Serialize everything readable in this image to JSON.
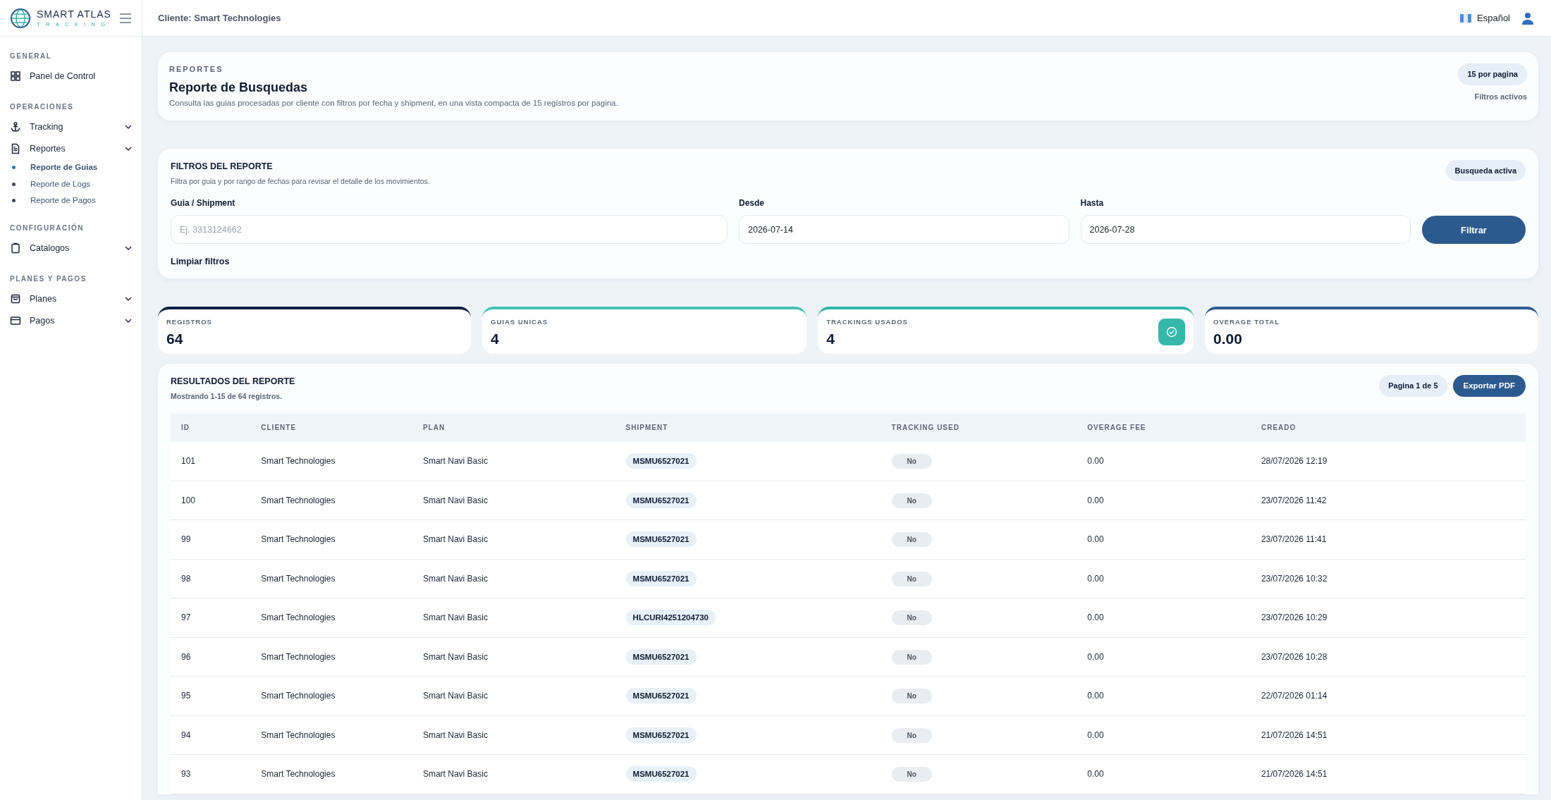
{
  "brand": {
    "name": "SMART ATLAS",
    "tagline": "TRACKING"
  },
  "header": {
    "client": "Cliente: Smart Technologies",
    "language": "Español"
  },
  "sidebar": [
    {
      "title": "GENERAL",
      "items": [
        {
          "label": "Panel de Control",
          "chevron": false
        }
      ]
    },
    {
      "title": "OPERACIONES",
      "items": [
        {
          "label": "Tracking",
          "chevron": true
        },
        {
          "label": "Reportes",
          "chevron": true,
          "children": [
            {
              "label": "Reporte de Guias",
              "selected": true
            },
            {
              "label": "Reporte de Logs",
              "selected": false
            },
            {
              "label": "Reporte de Pagos",
              "selected": false
            }
          ]
        }
      ]
    },
    {
      "title": "CONFIGURACIÓN",
      "items": [
        {
          "label": "Catalogos",
          "chevron": true
        }
      ]
    },
    {
      "title": "PLANES Y PAGOS",
      "items": [
        {
          "label": "Planes",
          "chevron": true
        },
        {
          "label": "Pagos",
          "chevron": true
        }
      ]
    }
  ],
  "hero": {
    "eyebrow": "REPORTES",
    "title": "Reporte de Busquedas",
    "description": "Consulta las guias procesadas por cliente con filtros por fecha y shipment, en una vista compacta de 15 registros por pagina.",
    "badge": "15 por pagina",
    "note": "Filtros activos"
  },
  "filters": {
    "title": "FILTROS DEL REPORTE",
    "description": "Filtra por guia y por rango de fechas para revisar el detalle de los movimientos.",
    "badge": "Busqueda activa",
    "fields": [
      {
        "label": "Guia / Shipment",
        "placeholder": "Ej. 3313124662"
      },
      {
        "label": "Desde",
        "value": "2026-07-14"
      },
      {
        "label": "Hasta",
        "value": "2026-07-28"
      }
    ],
    "submit": "Filtrar",
    "clear": "Limpiar filtros"
  },
  "stats": [
    {
      "label": "REGISTROS",
      "value": "64",
      "color": "#0f1f45",
      "icon": false
    },
    {
      "label": "GUIAS UNICAS",
      "value": "4",
      "color": "#45c2b5",
      "icon": false
    },
    {
      "label": "TRACKINGS USADOS",
      "value": "4",
      "color": "#2fb5a6",
      "icon": true
    },
    {
      "label": "OVERAGE TOTAL",
      "value": "0.00",
      "color": "#2c5a8f",
      "icon": false
    }
  ],
  "results": {
    "title": "RESULTADOS DEL REPORTE",
    "subtitle": "Mostrando 1-15 de 64 registros.",
    "page": "Pagina 1 de 5",
    "export": "Exportar PDF",
    "table": {
      "columns": [
        "ID",
        "CLIENTE",
        "PLAN",
        "SHIPMENT",
        "TRACKING USED",
        "OVERAGE FEE",
        "CREADO"
      ],
      "rows": [
        [
          "101",
          "Smart Technologies",
          "Smart Navi Basic",
          "MSMU6527021",
          "No",
          "0.00",
          "28/07/2026 12:19"
        ],
        [
          "100",
          "Smart Technologies",
          "Smart Navi Basic",
          "MSMU6527021",
          "No",
          "0.00",
          "23/07/2026 11:42"
        ],
        [
          "99",
          "Smart Technologies",
          "Smart Navi Basic",
          "MSMU6527021",
          "No",
          "0.00",
          "23/07/2026 11:41"
        ],
        [
          "98",
          "Smart Technologies",
          "Smart Navi Basic",
          "MSMU6527021",
          "No",
          "0.00",
          "23/07/2026 10:32"
        ],
        [
          "97",
          "Smart Technologies",
          "Smart Navi Basic",
          "HLCURI4251204730",
          "No",
          "0.00",
          "23/07/2026 10:29"
        ],
        [
          "96",
          "Smart Technologies",
          "Smart Navi Basic",
          "MSMU6527021",
          "No",
          "0.00",
          "23/07/2026 10:28"
        ],
        [
          "95",
          "Smart Technologies",
          "Smart Navi Basic",
          "MSMU6527021",
          "No",
          "0.00",
          "22/07/2026 01:14"
        ],
        [
          "94",
          "Smart Technologies",
          "Smart Navi Basic",
          "MSMU6527021",
          "No",
          "0.00",
          "21/07/2026 14:51"
        ],
        [
          "93",
          "Smart Technologies",
          "Smart Navi Basic",
          "MSMU6527021",
          "No",
          "0.00",
          "21/07/2026 14:51"
        ]
      ]
    }
  }
}
